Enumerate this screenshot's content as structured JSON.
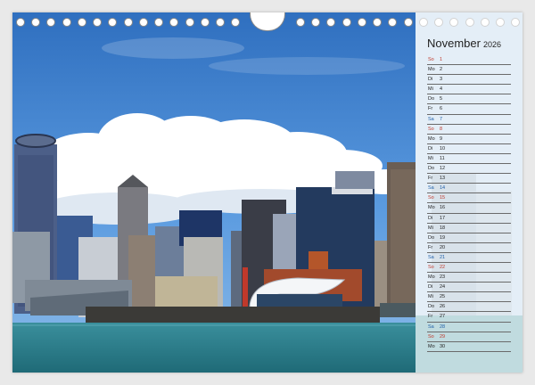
{
  "calendar": {
    "month": "November",
    "year": "2026",
    "days": [
      {
        "name": "So",
        "date": "1",
        "type": "sun"
      },
      {
        "name": "Mo",
        "date": "2",
        "type": "week"
      },
      {
        "name": "Di",
        "date": "3",
        "type": "week"
      },
      {
        "name": "Mi",
        "date": "4",
        "type": "week"
      },
      {
        "name": "Do",
        "date": "5",
        "type": "week"
      },
      {
        "name": "Fr",
        "date": "6",
        "type": "week"
      },
      {
        "name": "Sa",
        "date": "7",
        "type": "sat"
      },
      {
        "name": "So",
        "date": "8",
        "type": "sun"
      },
      {
        "name": "Mo",
        "date": "9",
        "type": "week"
      },
      {
        "name": "Di",
        "date": "10",
        "type": "week"
      },
      {
        "name": "Mi",
        "date": "11",
        "type": "week"
      },
      {
        "name": "Do",
        "date": "12",
        "type": "week"
      },
      {
        "name": "Fr",
        "date": "13",
        "type": "week"
      },
      {
        "name": "Sa",
        "date": "14",
        "type": "sat"
      },
      {
        "name": "So",
        "date": "15",
        "type": "sun"
      },
      {
        "name": "Mo",
        "date": "16",
        "type": "week"
      },
      {
        "name": "Di",
        "date": "17",
        "type": "week"
      },
      {
        "name": "Mi",
        "date": "18",
        "type": "week"
      },
      {
        "name": "Do",
        "date": "19",
        "type": "week"
      },
      {
        "name": "Fr",
        "date": "20",
        "type": "week"
      },
      {
        "name": "Sa",
        "date": "21",
        "type": "sat"
      },
      {
        "name": "So",
        "date": "22",
        "type": "sun"
      },
      {
        "name": "Mo",
        "date": "23",
        "type": "week"
      },
      {
        "name": "Di",
        "date": "24",
        "type": "week"
      },
      {
        "name": "Mi",
        "date": "25",
        "type": "week"
      },
      {
        "name": "Do",
        "date": "26",
        "type": "week"
      },
      {
        "name": "Fr",
        "date": "27",
        "type": "week"
      },
      {
        "name": "Sa",
        "date": "28",
        "type": "sat"
      },
      {
        "name": "So",
        "date": "29",
        "type": "sun"
      },
      {
        "name": "Mo",
        "date": "30",
        "type": "week"
      }
    ]
  },
  "colors": {
    "weekday": "#222222",
    "saturday": "#1f5fa8",
    "sunday": "#c0392b",
    "sky": "#3f86d1",
    "water": "#2e7f8c"
  }
}
